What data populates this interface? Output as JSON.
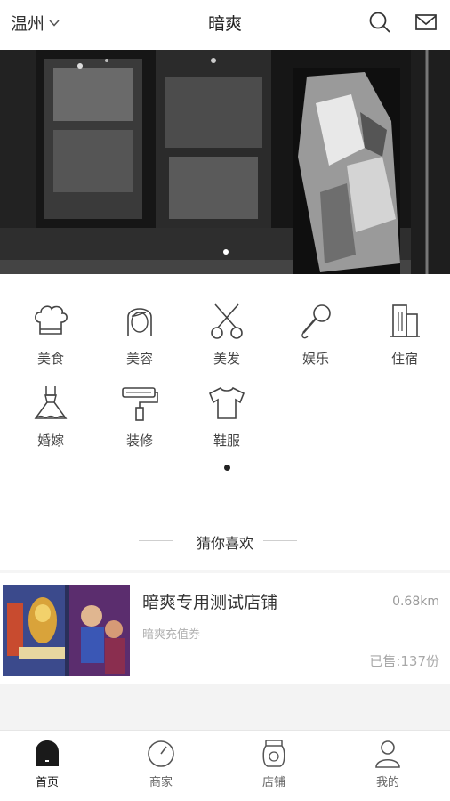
{
  "header": {
    "city": "温州",
    "title": "暗爽"
  },
  "categories": [
    {
      "label": "美食",
      "icon": "chef-hat-icon"
    },
    {
      "label": "美容",
      "icon": "woman-face-icon"
    },
    {
      "label": "美发",
      "icon": "scissors-icon"
    },
    {
      "label": "娱乐",
      "icon": "microphone-icon"
    },
    {
      "label": "住宿",
      "icon": "building-icon"
    },
    {
      "label": "婚嫁",
      "icon": "wedding-dress-icon"
    },
    {
      "label": "装修",
      "icon": "paint-roller-icon"
    },
    {
      "label": "鞋服",
      "icon": "tshirt-icon"
    }
  ],
  "section": {
    "guess_title": "猜你喜欢"
  },
  "store": {
    "name": "暗爽专用测试店铺",
    "distance": "0.68km",
    "subtitle": "暗爽充值券",
    "sold": "已售:137份"
  },
  "tabbar": {
    "items": [
      {
        "label": "首页",
        "active": true
      },
      {
        "label": "商家",
        "active": false
      },
      {
        "label": "店铺",
        "active": false
      },
      {
        "label": "我的",
        "active": false
      }
    ]
  },
  "colors": {
    "text": "#333333",
    "muted": "#9a9a9a",
    "divider": "#f3f3f3"
  }
}
